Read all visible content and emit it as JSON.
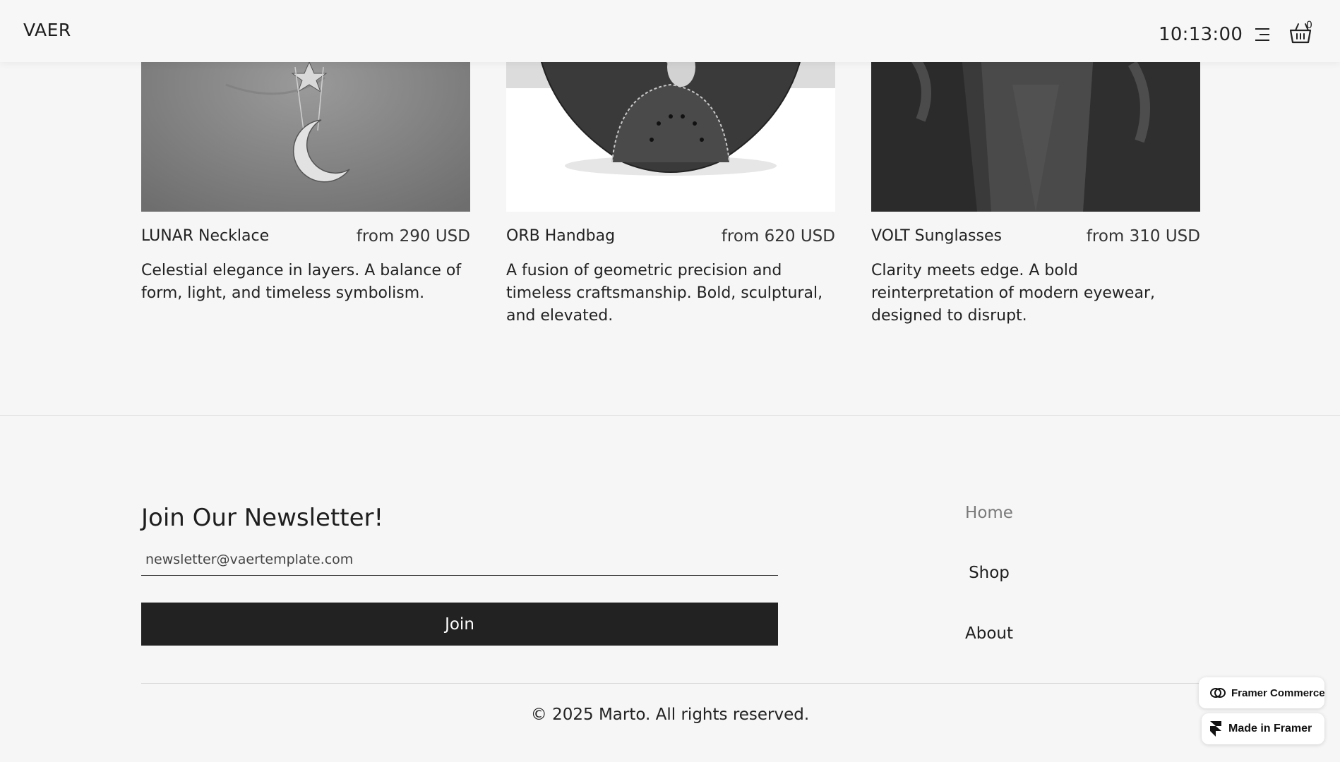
{
  "header": {
    "logo": "VAER",
    "clock": "10:13:00",
    "cart_count": "0"
  },
  "products": [
    {
      "name": "LUNAR Necklace",
      "price": "from 290 USD",
      "description": "Celestial elegance in layers. A balance of form, light, and timeless symbolism."
    },
    {
      "name": "ORB Handbag",
      "price": "from 620 USD",
      "description": "A fusion of geometric precision and timeless craftsmanship. Bold, sculptural, and elevated."
    },
    {
      "name": "VOLT Sunglasses",
      "price": "from 310 USD",
      "description": "Clarity meets edge. A bold reinterpretation of modern eyewear, designed to disrupt."
    }
  ],
  "newsletter": {
    "title": "Join Our Newsletter!",
    "email_placeholder": "newsletter@vaertemplate.com",
    "join_label": "Join"
  },
  "footer_nav": {
    "home": "Home",
    "shop": "Shop",
    "about": "About"
  },
  "copyright": "© 2025 Marto. All rights reserved.",
  "badges": {
    "commerce": "Framer Commerce",
    "made_in": "Made in Framer"
  },
  "colors": {
    "background": "#f6f6f6",
    "button": "#222222",
    "active_link": "#7a7a7a"
  }
}
